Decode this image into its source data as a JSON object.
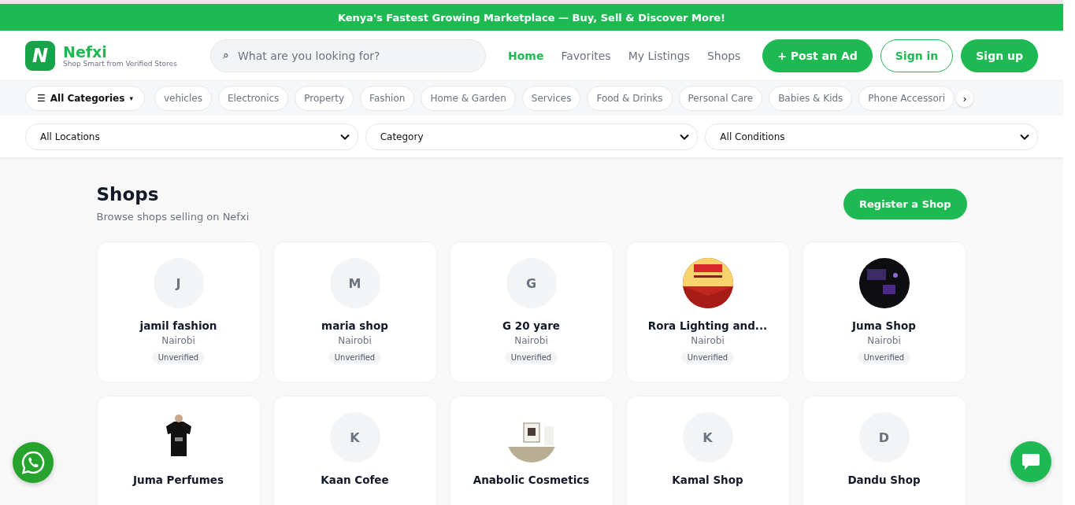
{
  "banner": {
    "text": "Kenya's Fastest Growing Marketplace — Buy, Sell & Discover More!"
  },
  "header": {
    "logo": {
      "letter": "N",
      "name": "Nefxi",
      "tagline": "Shop Smart from Verified Stores"
    },
    "search": {
      "icon": "⌕",
      "placeholder": "What are you looking for?"
    },
    "nav": [
      {
        "label": "Home",
        "selected": true
      },
      {
        "label": "Favorites",
        "selected": false
      },
      {
        "label": "My Listings",
        "selected": false
      },
      {
        "label": "Shops",
        "selected": false
      }
    ],
    "buttons": [
      {
        "label": "+ Post an Ad",
        "kind": "solid"
      },
      {
        "label": "Sign in",
        "kind": "outline"
      },
      {
        "label": "Sign up",
        "kind": "solid"
      }
    ]
  },
  "categories": {
    "menu": {
      "icon": "☰",
      "label": "All Categories",
      "caret": "▾"
    },
    "chips": [
      "vehicles",
      "Electronics",
      "Property",
      "Fashion",
      "Home & Garden",
      "Services",
      "Food & Drinks",
      "Personal Care",
      "Babies & Kids",
      "Phone Accessori"
    ],
    "next": "›"
  },
  "filters": [
    "All Locations",
    "Category",
    "All Conditions"
  ],
  "page": {
    "title": "Shops",
    "subtitle": "Browse shops selling on Nefxi",
    "action": "Register a Shop"
  },
  "shops": [
    {
      "name": "jamil fashion",
      "location": "Nairobi",
      "badge": "Unverified",
      "avatar": {
        "kind": "letter",
        "letter": "J"
      }
    },
    {
      "name": "maria shop",
      "location": "Nairobi",
      "badge": "Unverified",
      "avatar": {
        "kind": "letter",
        "letter": "M"
      }
    },
    {
      "name": "G 20 yare",
      "location": "Nairobi",
      "badge": "Unverified",
      "avatar": {
        "kind": "letter",
        "letter": "G"
      }
    },
    {
      "name": "Rora Lighting and...",
      "location": "Nairobi",
      "badge": "Unverified"
    },
    {
      "name": "Juma Shop",
      "location": "Nairobi",
      "badge": "Unverified"
    },
    {
      "name": "Juma Perfumes"
    },
    {
      "name": "Kaan Cofee",
      "avatar": {
        "kind": "letter",
        "letter": "K"
      }
    },
    {
      "name": "Anabolic Cosmetics"
    },
    {
      "name": "Kamal Shop",
      "avatar": {
        "kind": "letter",
        "letter": "K"
      }
    },
    {
      "name": "Dandu Shop",
      "avatar": {
        "kind": "letter",
        "letter": "D"
      }
    }
  ]
}
